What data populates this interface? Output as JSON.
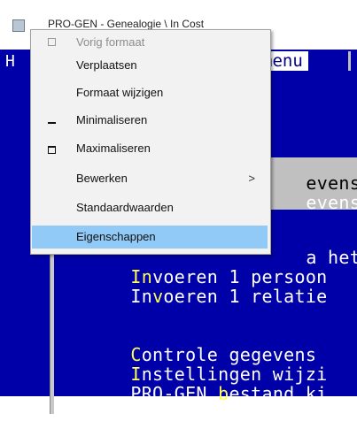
{
  "window": {
    "title": "PRO-GEN - Genealogie \\ In Cost"
  },
  "console": {
    "menubar": {
      "left_label": "H",
      "menu_label": "menu"
    },
    "lines": [
      {
        "pre": "",
        "hk": "",
        "post": "evens",
        "hilite": true
      },
      {
        "pre": "",
        "hk": "",
        "post": "evens",
        "hilite": false
      },
      {
        "pre": "",
        "hk": "",
        "post": "a het",
        "hilite": false
      },
      {
        "pre": "",
        "hk": "In",
        "post": "voeren 1 persoon"
      },
      {
        "pre": "In",
        "hk": "v",
        "post": "oeren 1 relatie"
      },
      {
        "pre": "",
        "hk": "C",
        "post": "ontrole gegevens"
      },
      {
        "pre": "",
        "hk": "I",
        "post": "nstellingen wijzi"
      },
      {
        "pre": "PRO-GEN ",
        "hk": "b",
        "post": "estand ki"
      }
    ]
  },
  "context_menu": {
    "items": [
      {
        "label": "Vorig formaat",
        "icon": "restore-icon",
        "disabled": true
      },
      {
        "label": "Verplaatsen",
        "icon": ""
      },
      {
        "label": "Formaat wijzigen",
        "icon": ""
      },
      {
        "label": "Minimaliseren",
        "icon": "minimize-icon"
      },
      {
        "label": "Maximaliseren",
        "icon": "maximize-icon"
      },
      {
        "label": "Bewerken",
        "icon": "",
        "submenu": ">"
      },
      {
        "label": "Standaardwaarden",
        "icon": ""
      },
      {
        "label": "Eigenschappen",
        "icon": "",
        "selected": true
      }
    ]
  },
  "colors": {
    "console_bg": "#0000a8",
    "hotkey": "#ffff55",
    "menu_selected": "#91c9f7"
  }
}
